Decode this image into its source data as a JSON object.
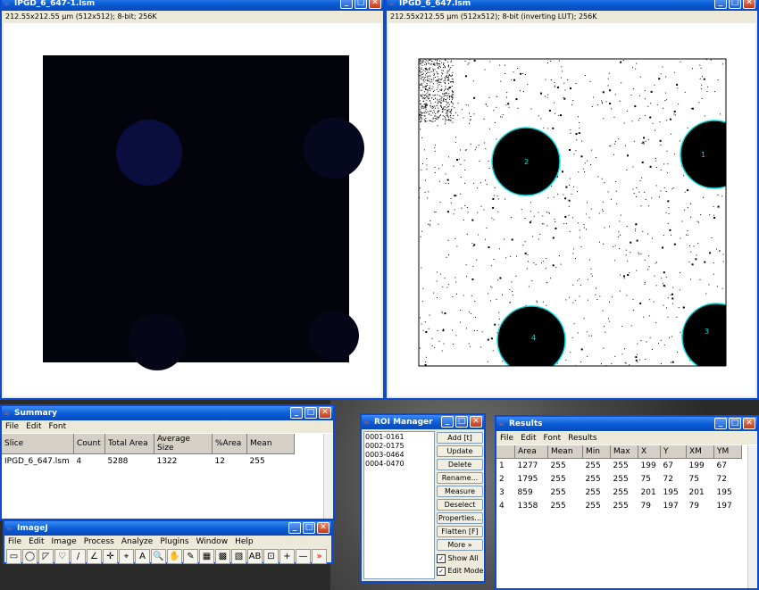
{
  "colors": {
    "title_bar": "#0b5ed7",
    "roi_outline": "#00e0e0",
    "image_blue": "#2222aa"
  },
  "window1": {
    "title": "IPGD_6_647-1.lsm",
    "info": "212.55x212.55 µm (512x512); 8-bit; 256K"
  },
  "window2": {
    "title": "IPGD_6_647.lsm",
    "info": "212.55x212.55 µm (512x512); 8-bit (inverting LUT); 256K",
    "roi_labels": [
      "1",
      "2",
      "3",
      "4"
    ]
  },
  "summary": {
    "title": "Summary",
    "menu": [
      "File",
      "Edit",
      "Font"
    ],
    "columns": [
      "Slice",
      "Count",
      "Total Area",
      "Average Size",
      "%Area",
      "Mean"
    ],
    "rows": [
      [
        "IPGD_6_647.lsm",
        "4",
        "5288",
        "1322",
        "12",
        "255"
      ]
    ]
  },
  "imagej": {
    "title": "ImageJ",
    "menu": [
      "File",
      "Edit",
      "Image",
      "Process",
      "Analyze",
      "Plugins",
      "Window",
      "Help"
    ],
    "tools": [
      "rectangle-tool-icon",
      "oval-tool-icon",
      "polygon-tool-icon",
      "freehand-tool-icon",
      "line-tool-icon",
      "angle-tool-icon",
      "point-tool-icon",
      "wand-tool-icon",
      "text-tool-icon",
      "magnifier-tool-icon",
      "hand-tool-icon",
      "color-picker-icon",
      "stacks-icon",
      "luts-icon",
      "dev-icon",
      "pencil-icon",
      "brush-icon",
      "plus-icon",
      "minus-icon",
      "more-tools-icon"
    ],
    "tool_glyphs": [
      "▭",
      "◯",
      "◸",
      "♡",
      "∕",
      "∠",
      "✛",
      "⌖",
      "A",
      "🔍",
      "✋",
      "✎",
      "▦",
      "▩",
      "▧",
      "AB",
      "⊡",
      "+",
      "—",
      "»"
    ]
  },
  "roi_manager": {
    "title": "ROI Manager",
    "items": [
      "0001-0161",
      "0002-0175",
      "0003-0464",
      "0004-0470"
    ],
    "buttons": [
      "Add [t]",
      "Update",
      "Delete",
      "Rename...",
      "Measure",
      "Deselect",
      "Properties...",
      "Flatten [F]",
      "More »"
    ],
    "show_all": "Show All",
    "edit_mode": "Edit Mode"
  },
  "results": {
    "title": "Results",
    "menu": [
      "File",
      "Edit",
      "Font",
      "Results"
    ],
    "columns": [
      "",
      "Area",
      "Mean",
      "Min",
      "Max",
      "X",
      "Y",
      "XM",
      "YM"
    ],
    "rows": [
      [
        "1",
        "1277",
        "255",
        "255",
        "255",
        "199",
        "67",
        "199",
        "67"
      ],
      [
        "2",
        "1795",
        "255",
        "255",
        "255",
        "75",
        "72",
        "75",
        "72"
      ],
      [
        "3",
        "859",
        "255",
        "255",
        "255",
        "201",
        "195",
        "201",
        "195"
      ],
      [
        "4",
        "1358",
        "255",
        "255",
        "255",
        "79",
        "197",
        "79",
        "197"
      ]
    ]
  }
}
